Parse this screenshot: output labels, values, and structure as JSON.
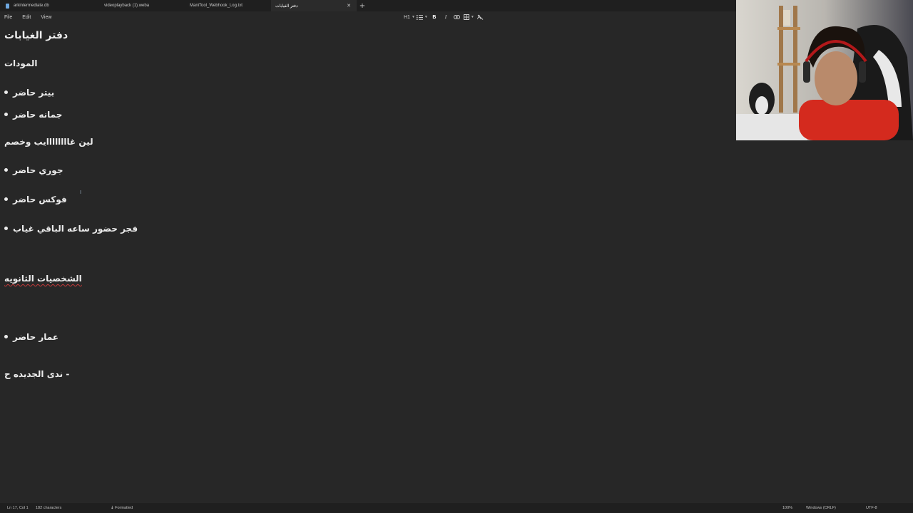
{
  "tabs": [
    {
      "label": "arkintermediate.db",
      "active": false
    },
    {
      "label": "videoplayback (1).weba",
      "active": false
    },
    {
      "label": "ManiTool_Webhook_Log.txt",
      "active": false
    },
    {
      "label": "دفتر الغيابات",
      "active": true
    }
  ],
  "menu": [
    "File",
    "Edit",
    "View"
  ],
  "toolbar": {
    "heading": "H1",
    "bold": "B",
    "italic": "I"
  },
  "document": {
    "title": "دفتر الغيابات",
    "section1": "المودات",
    "item1": "بيتر حاضر",
    "item2": "جمانه حاضر",
    "line_lyn": "لين غاااااااايب وخصم",
    "item3": "جوري حاضر",
    "item4": "فوكس حاضر",
    "item5": "فجر حضور ساعه الباقي غياب",
    "section2": "الشخصيات الثانويه",
    "item6": "عمار حاضر",
    "line_nada": "ندى الجديده ح -"
  },
  "status": {
    "position": "Ln 17, Col 1",
    "characters": "182 characters",
    "mode": "Formatted",
    "zoom": "100%",
    "line_ending": "Windows (CRLF)",
    "encoding": "UTF-8"
  },
  "colors": {
    "background": "#272727",
    "tabbar": "#1f1f1f",
    "text": "#ececec",
    "accent": "#6ea8e0"
  }
}
